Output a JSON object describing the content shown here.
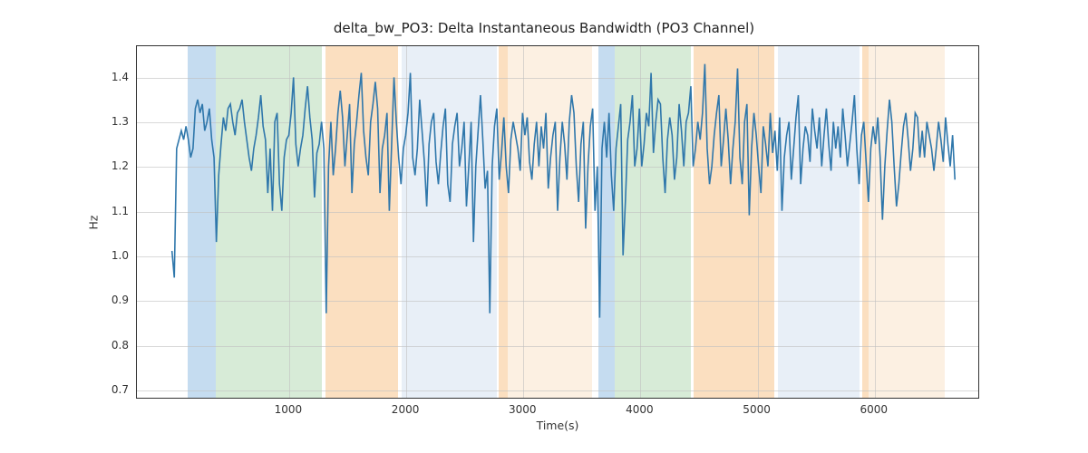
{
  "title": "delta_bw_PO3: Delta Instantaneous Bandwidth (PO3 Channel)",
  "xlabel": "Time(s)",
  "ylabel": "Hz",
  "chart_data": {
    "type": "line",
    "xlim": [
      -300,
      6900
    ],
    "ylim": [
      0.68,
      1.47
    ],
    "xticks": [
      1000,
      2000,
      3000,
      4000,
      5000,
      6000
    ],
    "yticks": [
      0.7,
      0.8,
      0.9,
      1.0,
      1.1,
      1.2,
      1.3,
      1.4
    ],
    "bands": [
      {
        "x0": 130,
        "x1": 370,
        "color": 0
      },
      {
        "x0": 370,
        "x1": 1280,
        "color": 1
      },
      {
        "x0": 1310,
        "x1": 1930,
        "color": 2
      },
      {
        "x0": 1960,
        "x1": 2770,
        "color": 3
      },
      {
        "x0": 2790,
        "x1": 2870,
        "color": 2
      },
      {
        "x0": 2870,
        "x1": 3590,
        "color": 4
      },
      {
        "x0": 3640,
        "x1": 3780,
        "color": 0
      },
      {
        "x0": 3780,
        "x1": 4430,
        "color": 1
      },
      {
        "x0": 4450,
        "x1": 5140,
        "color": 2
      },
      {
        "x0": 5170,
        "x1": 5870,
        "color": 3
      },
      {
        "x0": 5890,
        "x1": 5950,
        "color": 2
      },
      {
        "x0": 5950,
        "x1": 6600,
        "color": 4
      }
    ],
    "series": [
      {
        "name": "delta_bw_PO3",
        "x_start": 0,
        "x_step": 20,
        "y": [
          1.01,
          0.95,
          1.24,
          1.26,
          1.28,
          1.26,
          1.29,
          1.26,
          1.22,
          1.24,
          1.33,
          1.35,
          1.32,
          1.34,
          1.28,
          1.3,
          1.33,
          1.26,
          1.22,
          1.03,
          1.18,
          1.25,
          1.31,
          1.28,
          1.33,
          1.34,
          1.3,
          1.27,
          1.32,
          1.33,
          1.35,
          1.3,
          1.26,
          1.22,
          1.19,
          1.24,
          1.27,
          1.31,
          1.36,
          1.29,
          1.26,
          1.14,
          1.24,
          1.1,
          1.3,
          1.32,
          1.16,
          1.1,
          1.22,
          1.26,
          1.27,
          1.32,
          1.4,
          1.25,
          1.2,
          1.24,
          1.27,
          1.33,
          1.38,
          1.31,
          1.26,
          1.13,
          1.23,
          1.25,
          1.3,
          1.24,
          0.87,
          1.2,
          1.3,
          1.18,
          1.24,
          1.32,
          1.37,
          1.31,
          1.2,
          1.27,
          1.34,
          1.14,
          1.25,
          1.3,
          1.36,
          1.41,
          1.28,
          1.22,
          1.18,
          1.3,
          1.34,
          1.39,
          1.33,
          1.14,
          1.24,
          1.27,
          1.32,
          1.1,
          1.25,
          1.4,
          1.3,
          1.22,
          1.16,
          1.24,
          1.27,
          1.32,
          1.41,
          1.22,
          1.18,
          1.24,
          1.35,
          1.28,
          1.21,
          1.11,
          1.25,
          1.3,
          1.32,
          1.21,
          1.16,
          1.23,
          1.29,
          1.33,
          1.16,
          1.12,
          1.25,
          1.29,
          1.32,
          1.2,
          1.24,
          1.3,
          1.11,
          1.2,
          1.3,
          1.03,
          1.2,
          1.28,
          1.36,
          1.26,
          1.15,
          1.19,
          0.87,
          1.2,
          1.29,
          1.33,
          1.17,
          1.23,
          1.31,
          1.2,
          1.14,
          1.26,
          1.3,
          1.27,
          1.24,
          1.19,
          1.32,
          1.27,
          1.31,
          1.21,
          1.17,
          1.25,
          1.3,
          1.2,
          1.29,
          1.24,
          1.32,
          1.15,
          1.22,
          1.27,
          1.3,
          1.1,
          1.22,
          1.3,
          1.25,
          1.17,
          1.3,
          1.36,
          1.32,
          1.2,
          1.12,
          1.25,
          1.3,
          1.06,
          1.2,
          1.29,
          1.33,
          1.1,
          1.2,
          0.86,
          1.24,
          1.3,
          1.22,
          1.32,
          1.18,
          1.1,
          1.24,
          1.29,
          1.34,
          1.0,
          1.12,
          1.26,
          1.3,
          1.36,
          1.2,
          1.24,
          1.33,
          1.2,
          1.25,
          1.32,
          1.29,
          1.41,
          1.23,
          1.3,
          1.35,
          1.34,
          1.22,
          1.14,
          1.26,
          1.31,
          1.27,
          1.17,
          1.22,
          1.34,
          1.28,
          1.2,
          1.3,
          1.32,
          1.38,
          1.2,
          1.24,
          1.3,
          1.26,
          1.32,
          1.43,
          1.24,
          1.16,
          1.2,
          1.27,
          1.32,
          1.36,
          1.2,
          1.26,
          1.33,
          1.26,
          1.16,
          1.24,
          1.3,
          1.42,
          1.22,
          1.16,
          1.3,
          1.34,
          1.09,
          1.24,
          1.32,
          1.27,
          1.2,
          1.14,
          1.29,
          1.25,
          1.2,
          1.32,
          1.23,
          1.28,
          1.19,
          1.31,
          1.1,
          1.22,
          1.27,
          1.3,
          1.17,
          1.24,
          1.31,
          1.36,
          1.16,
          1.24,
          1.29,
          1.27,
          1.21,
          1.33,
          1.28,
          1.24,
          1.31,
          1.2,
          1.27,
          1.33,
          1.25,
          1.19,
          1.3,
          1.24,
          1.29,
          1.22,
          1.33,
          1.27,
          1.2,
          1.25,
          1.3,
          1.36,
          1.24,
          1.16,
          1.27,
          1.3,
          1.21,
          1.12,
          1.24,
          1.29,
          1.25,
          1.31,
          1.22,
          1.08,
          1.2,
          1.28,
          1.35,
          1.3,
          1.2,
          1.11,
          1.16,
          1.23,
          1.29,
          1.32,
          1.26,
          1.19,
          1.24,
          1.32,
          1.31,
          1.22,
          1.28,
          1.22,
          1.3,
          1.27,
          1.24,
          1.19,
          1.24,
          1.3,
          1.26,
          1.21,
          1.31,
          1.25,
          1.2,
          1.27,
          1.17
        ]
      }
    ]
  }
}
